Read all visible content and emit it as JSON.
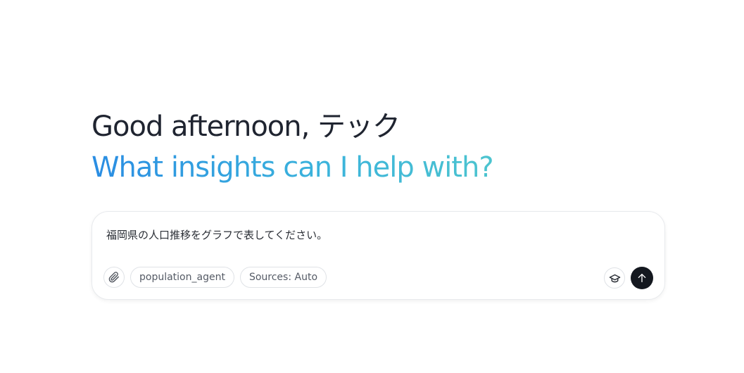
{
  "header": {
    "greeting": "Good afternoon, テック",
    "subtitle": "What insights can I help with?"
  },
  "composer": {
    "input_value": "福岡県の人口推移をグラフで表してください。",
    "attach_icon": "paperclip-icon",
    "chips": {
      "agent_label": "population_agent",
      "sources_label": "Sources: Auto"
    },
    "learn_icon": "graduation-cap-icon",
    "send_icon": "arrow-up-icon"
  },
  "colors": {
    "greeting_text": "#1f2430",
    "gradient_start": "#2a8de3",
    "gradient_end": "#4cc4cf",
    "send_button_bg": "#14181f"
  }
}
